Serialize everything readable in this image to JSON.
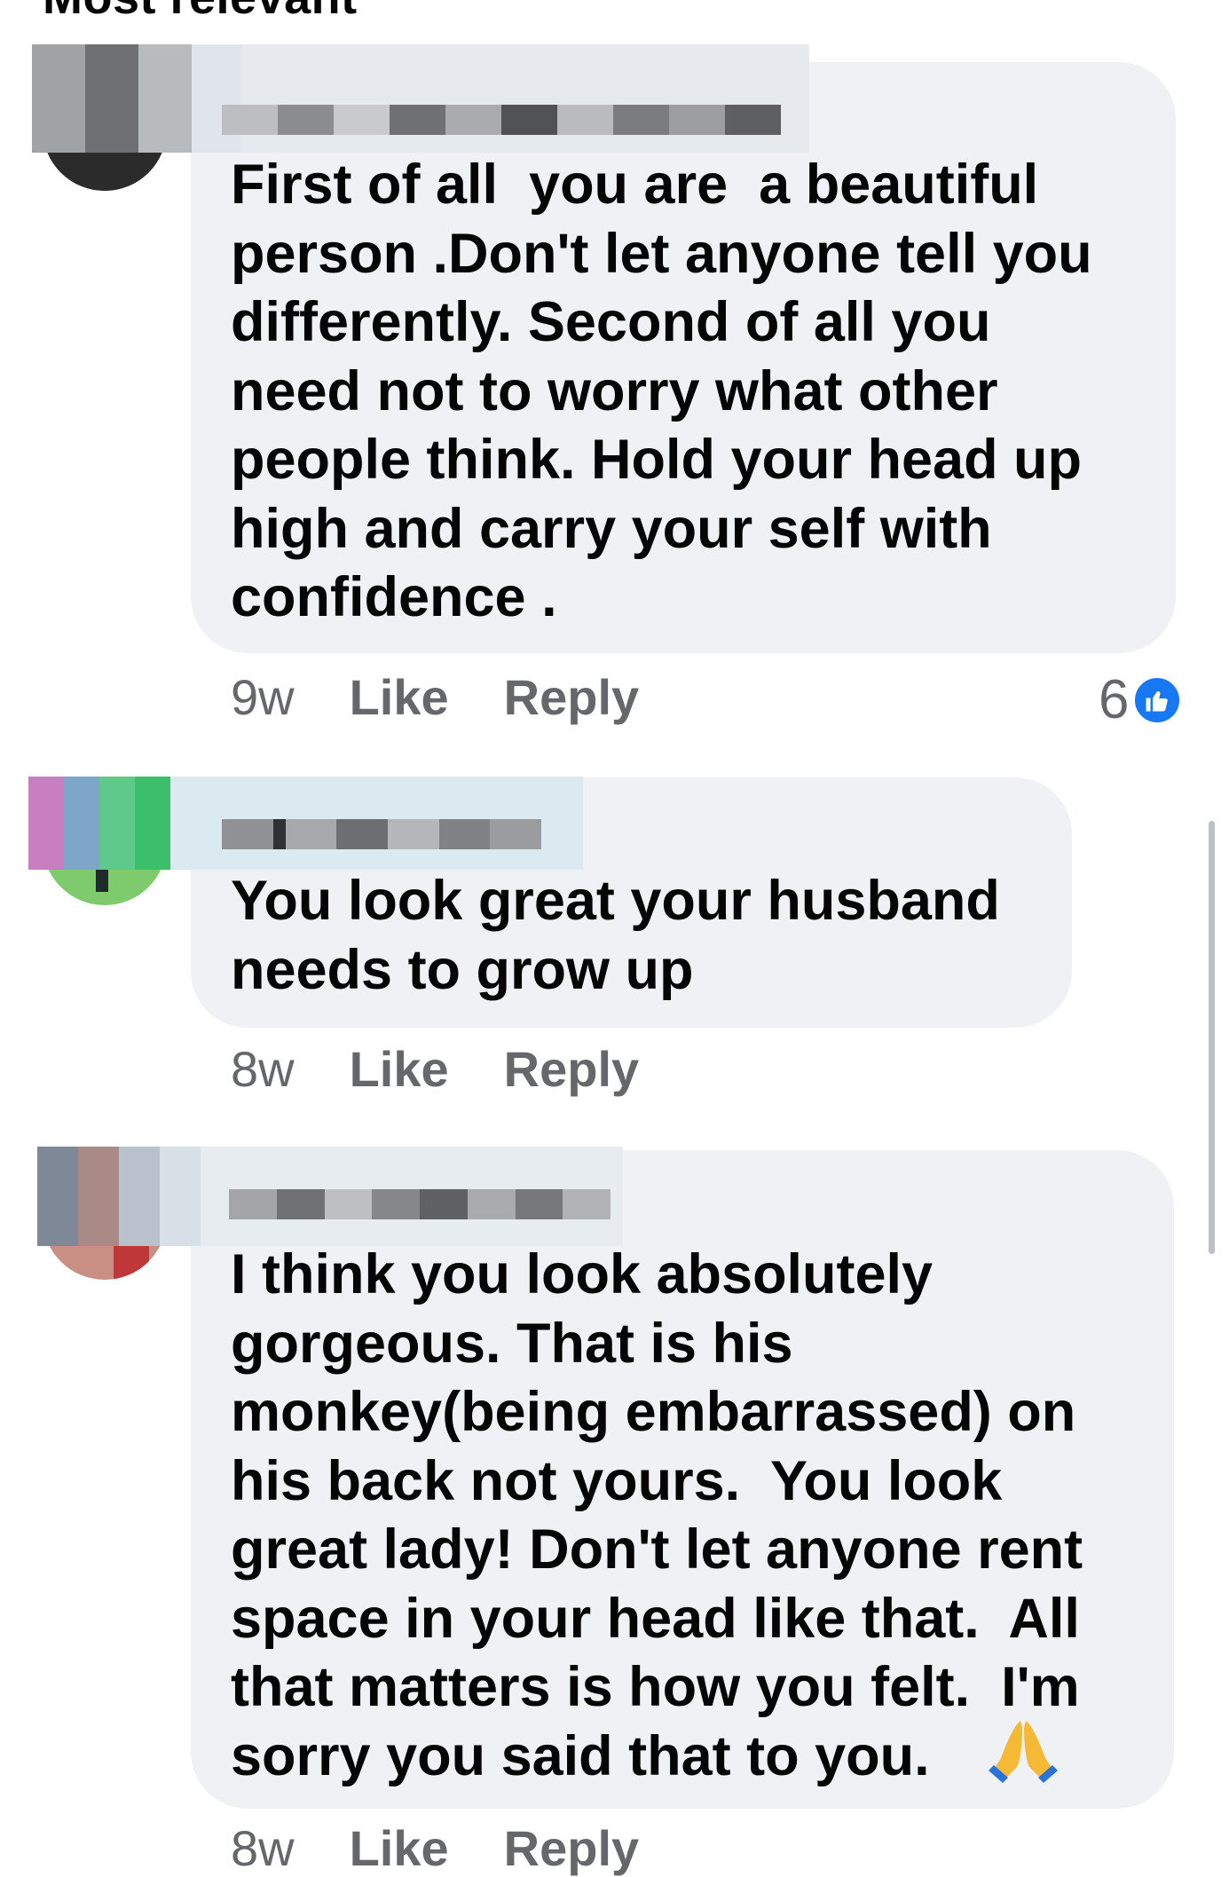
{
  "section_heading": "Most relevant",
  "comments": [
    {
      "text": "First of all  you are  a beautiful\nperson .Don't let anyone tell you\ndifferently. Second of all you\nneed not to worry what other\npeople think. Hold your head up\nhigh and carry your self with\nconfidence .",
      "time": "9w",
      "like_label": "Like",
      "reply_label": "Reply",
      "reaction_count": "6",
      "reaction_icon": "thumbs-up-icon"
    },
    {
      "text": "You look great your husband\nneeds to grow up",
      "time": "8w",
      "like_label": "Like",
      "reply_label": "Reply"
    },
    {
      "text": "I think you look absolutely\ngorgeous. That is his\nmonkey(being embarrassed) on\nhis back not yours.  You look\ngreat lady! Don't let anyone rent\nspace in your head like that.  All\nthat matters is how you felt.  I'm\nsorry you said that to you.",
      "emoji": "folded-hands-emoji",
      "time": "8w",
      "like_label": "Like",
      "reply_label": "Reply"
    }
  ],
  "colors": {
    "bubble": "#eff1f5",
    "meta_text": "#65676b",
    "like_blue": "#1877f2"
  }
}
